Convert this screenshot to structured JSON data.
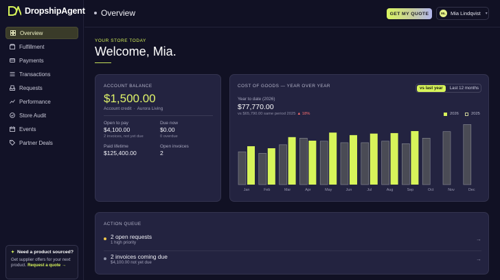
{
  "app": {
    "name": "DropshipAgent"
  },
  "sidebar": {
    "items": [
      {
        "label": "Overview",
        "icon": "grid-icon",
        "active": true
      },
      {
        "label": "Fulfillment",
        "icon": "box-icon",
        "active": false
      },
      {
        "label": "Payments",
        "icon": "card-icon",
        "active": false
      },
      {
        "label": "Transactions",
        "icon": "list-icon",
        "active": false
      },
      {
        "label": "Requests",
        "icon": "inbox-icon",
        "active": false
      },
      {
        "label": "Performance",
        "icon": "chart-icon",
        "active": false
      },
      {
        "label": "Store Audit",
        "icon": "check-icon",
        "active": false
      },
      {
        "label": "Events",
        "icon": "calendar-icon",
        "active": false
      },
      {
        "label": "Partner Deals",
        "icon": "tag-icon",
        "active": false
      }
    ],
    "promo": {
      "title": "Need a product sourced?",
      "body": "Get supplier offers for your next product.",
      "link": "Request a quote →"
    }
  },
  "header": {
    "title": "Overview",
    "quote_button": "GET MY QUOTE",
    "user": {
      "name": "Mia Lindqvist",
      "initials": "ML"
    }
  },
  "welcome": {
    "eyebrow": "YOUR STORE TODAY",
    "heading": "Welcome, Mia."
  },
  "balance": {
    "label": "ACCOUNT BALANCE",
    "amount": "$1,500.00",
    "account_type": "Account credit",
    "account_name": "Aurora Living",
    "open_to_pay": {
      "label": "Open to pay",
      "value": "$4,100.00",
      "note": "2 invoices, not yet due"
    },
    "due_now": {
      "label": "Due now",
      "value": "$0.00",
      "note": "0 overdue"
    },
    "paid_lifetime": {
      "label": "Paid lifetime",
      "value": "$125,400.00"
    },
    "open_invoices": {
      "label": "Open invoices",
      "value": "2"
    }
  },
  "cogs": {
    "title": "COST OF GOODS — YEAR OVER YEAR",
    "toggle": {
      "active": "vs last year",
      "inactive": "Last 12 months"
    },
    "ytd_label": "Year to date (2026)",
    "ytd_value": "$77,770.00",
    "compare_text": "vs $65,790.00 same period 2025",
    "delta": "▲ 18%",
    "legend": {
      "current": "2026",
      "previous": "2025"
    }
  },
  "chart_data": {
    "type": "bar",
    "categories": [
      "Jan",
      "Feb",
      "Mar",
      "Apr",
      "May",
      "Jun",
      "Jul",
      "Aug",
      "Sep",
      "Oct",
      "Nov",
      "Dec"
    ],
    "series": [
      {
        "name": "2025",
        "values": [
          6500,
          6200,
          7900,
          9200,
          8600,
          8300,
          8300,
          8600,
          8100,
          9200,
          10500,
          11900
        ]
      },
      {
        "name": "2026",
        "values": [
          7600,
          7200,
          9400,
          8700,
          10300,
          9800,
          10100,
          10200,
          10600,
          null,
          null,
          null
        ]
      }
    ],
    "ylim": [
      0,
      12500
    ],
    "colors": {
      "2026": "#d7f45a",
      "2025": "#4a4b55"
    },
    "grid": false,
    "legend_position": "top-right"
  },
  "queue": {
    "label": "ACTION QUEUE",
    "items": [
      {
        "title": "2 open requests",
        "sub": "1 high priority",
        "dot_color": "#f2c94c",
        "arrow": "→"
      },
      {
        "title": "2 invoices coming due",
        "sub": "$4,100.00 not yet due",
        "dot_color": "#8f92a8",
        "arrow": "→"
      }
    ]
  }
}
